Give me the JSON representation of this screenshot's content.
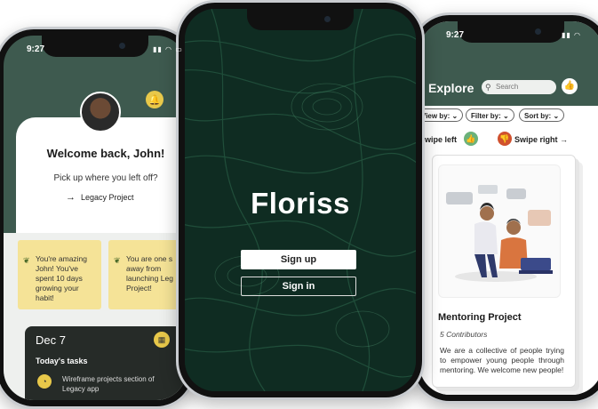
{
  "left_phone": {
    "time": "9:27",
    "welcome_title": "Welcome back, John!",
    "welcome_subtitle": "Pick up where you left off?",
    "continue_project": "Legacy Project",
    "notes": [
      {
        "text": "You're amazing John! You've spent 10 days growing your habit!"
      },
      {
        "text": "You are one s away from launching Leg Project!"
      }
    ],
    "tasks": {
      "date": "Dec 7",
      "heading": "Today's tasks",
      "item": "Wireframe projects section of Legacy app"
    }
  },
  "center_phone": {
    "app_name": "Floriss",
    "signup_label": "Sign up",
    "signin_label": "Sign in"
  },
  "right_phone": {
    "time": "9:27",
    "title": "Explore",
    "search_placeholder": "Search",
    "filters": [
      "View by:",
      "Filter by:",
      "Sort by:"
    ],
    "swipe_left_label": "Swipe left",
    "swipe_right_label": "Swipe right",
    "project": {
      "title": "Mentoring Project",
      "contributors": "5 Contributors",
      "description": "We are a collective of people trying to empower young people through mentoring. We welcome new people!"
    }
  },
  "colors": {
    "brand_green": "#3e5a4f",
    "dark_green": "#0f2c22",
    "accent_yellow": "#e8c84a",
    "note_yellow": "#f5e397",
    "like_green": "#6bb27a",
    "dislike_red": "#d0512e"
  },
  "icons": [
    "bell-icon",
    "arrow-right-icon",
    "sprout-icon",
    "calendar-icon",
    "pause-icon",
    "search-icon",
    "thumbs-up-icon",
    "thumbs-down-icon",
    "chevron-down-icon",
    "wifi-icon",
    "battery-icon"
  ]
}
